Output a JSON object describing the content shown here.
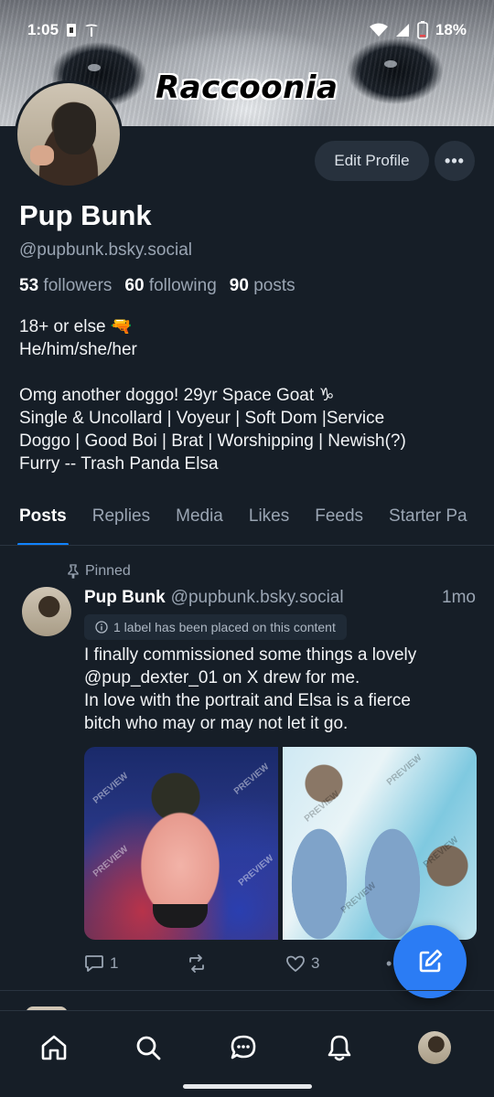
{
  "status_bar": {
    "time": "1:05",
    "battery": "18%"
  },
  "banner": {
    "title": "Raccoonia"
  },
  "profile": {
    "display_name": "Pup Bunk",
    "handle": "@pupbunk.bsky.social",
    "edit_label": "Edit Profile",
    "more_label": "•••",
    "stats": {
      "followers_count": "53",
      "followers_label": "followers",
      "following_count": "60",
      "following_label": "following",
      "posts_count": "90",
      "posts_label": "posts"
    },
    "bio_lines": [
      "18+ or else 🔫",
      "He/him/she/her",
      "",
      "Omg another doggo! 29yr Space Goat ♑",
      "Single & Uncollard | Voyeur | Soft Dom |Service",
      "Doggo | Good Boi | Brat | Worshipping | Newish(?)",
      "Furry -- Trash Panda Elsa"
    ]
  },
  "tabs": [
    "Posts",
    "Replies",
    "Media",
    "Likes",
    "Feeds",
    "Starter Pa"
  ],
  "post": {
    "pinned_label": "Pinned",
    "author_name": "Pup Bunk",
    "author_handle": "@pupbunk.bsky.social",
    "time": "1mo",
    "label_notice": "1 label has been placed on this content",
    "text_lines": [
      "I finally commissioned some things a lovely",
      "@pup_dexter_01 on X drew for me.",
      "In love with the portrait and Elsa is a fierce",
      "bitch who may or may not let it go."
    ],
    "watermark": "PREVIEW",
    "reply_count": "1",
    "like_count": "3"
  },
  "colors": {
    "accent": "#1083fe",
    "fab": "#2b7cf4",
    "background": "#161e27"
  }
}
